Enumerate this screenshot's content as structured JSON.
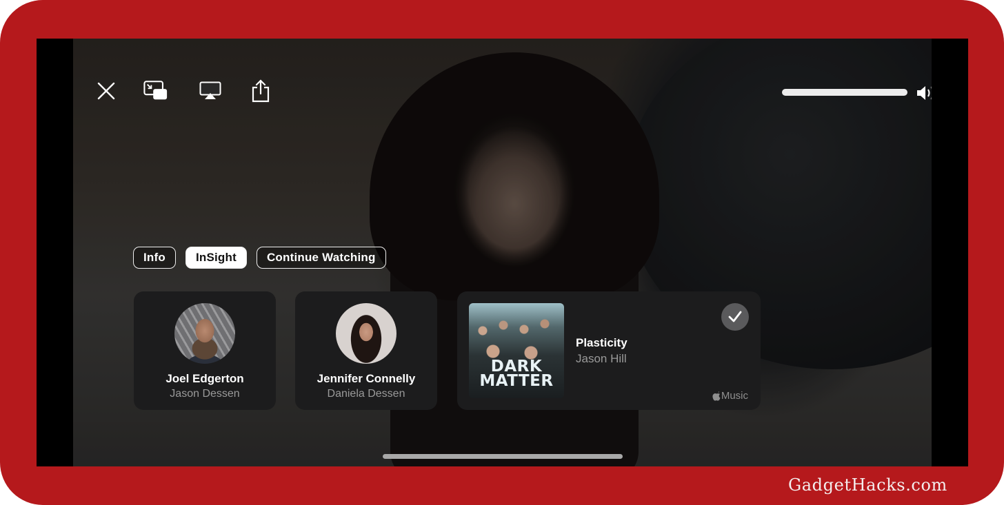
{
  "player": {
    "controls": {
      "close": "close-icon",
      "picture_in_picture": "pip-icon",
      "airplay": "airplay-icon",
      "share": "share-icon"
    },
    "volume": {
      "level": 1.0,
      "icon": "speaker-wave-icon"
    }
  },
  "tabs": [
    {
      "label": "Info",
      "active": false
    },
    {
      "label": "InSight",
      "active": true
    },
    {
      "label": "Continue Watching",
      "active": false
    }
  ],
  "cast": [
    {
      "name": "Joel Edgerton",
      "role": "Jason Dessen"
    },
    {
      "name": "Jennifer Connelly",
      "role": "Daniela Dessen"
    }
  ],
  "music": {
    "album_title": "DARK MATTER",
    "track": "Plasticity",
    "artist": "Jason Hill",
    "service": "Music",
    "added": true
  },
  "watermark": "GadgetHacks.com",
  "colors": {
    "frame": "#b5191c",
    "card": "#1c1c1d",
    "check_bg": "#5a5a5c"
  }
}
